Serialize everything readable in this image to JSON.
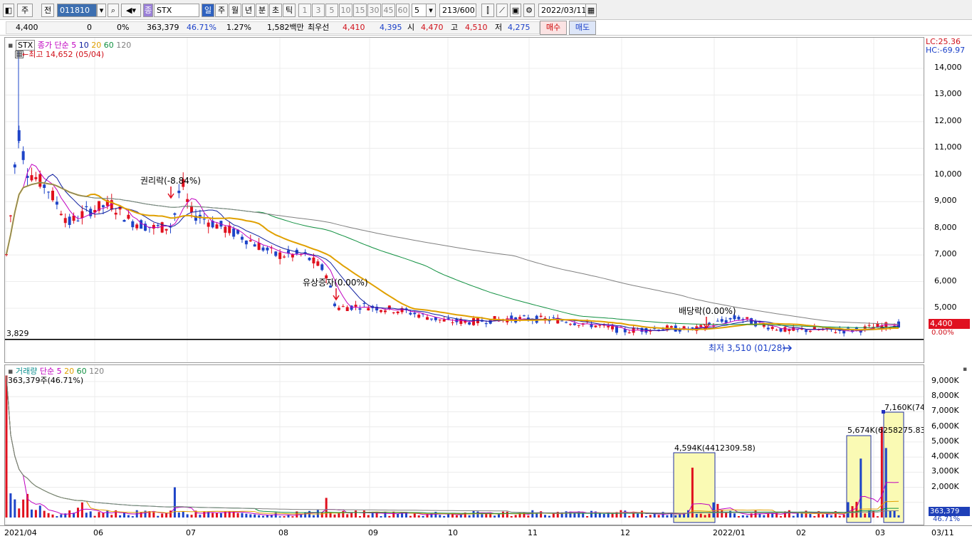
{
  "toolbar": {
    "period_type": "주",
    "prev_label": "전",
    "code": "011810",
    "name": "STX",
    "period_tabs": [
      "일",
      "주",
      "월",
      "년",
      "분",
      "초",
      "틱"
    ],
    "interval_tabs": [
      "1",
      "3",
      "5",
      "10",
      "15",
      "30",
      "45",
      "60"
    ],
    "interval_value": "5",
    "count": "213",
    "count_max": "/600",
    "date": "2022/03/11"
  },
  "quote": {
    "price": "4,400",
    "change": "0",
    "change_pct": "0%",
    "volume": "363,379",
    "turnover_pct": "46.71%",
    "vol_ratio": "1.27%",
    "amount": "1,582백만",
    "best_bid_label": "최우선",
    "best_ask": "4,410",
    "best_bid": "4,395",
    "open_label": "시",
    "open": "4,470",
    "high_label": "고",
    "high": "4,510",
    "low_label": "저",
    "low": "4,275",
    "buy_label": "매수",
    "sell_label": "매도"
  },
  "price_panel": {
    "symbol": "STX",
    "legend_title": "종가 단순",
    "legend_periods": [
      "5",
      "10",
      "20",
      "60",
      "120"
    ],
    "lc_label": "LC:25.36",
    "hc_label": "HC:-69.97",
    "max_label": "최고 14,652 (05/04)",
    "min_label": "최저 3,510 (01/28)",
    "line_value": "3,829",
    "current_price_label": "4,400",
    "current_pct_label": "0.00%",
    "annotations": [
      "권리락(-8.84%)",
      "유상증자(0.00%)",
      "배당락(0.00%)"
    ],
    "y_ticks": [
      "14,000",
      "13,000",
      "12,000",
      "11,000",
      "10,000",
      "9,000",
      "8,000",
      "7,000",
      "6,000",
      "5,000"
    ]
  },
  "volume_panel": {
    "legend_title": "거래량",
    "legend_ma": "단순",
    "legend_periods": [
      "5",
      "20",
      "60",
      "120"
    ],
    "volume_info": "363,379주(46.71%)",
    "callouts": [
      "4,594K(4412309.58)",
      "5,674K(6258275.83)",
      "7,160K(74"
    ],
    "y_ticks": [
      "9,000K",
      "8,000K",
      "7,000K",
      "6,000K",
      "5,000K",
      "4,000K",
      "3,000K",
      "2,000K"
    ],
    "current_volume_label": "363,379",
    "current_pct_label": "46.71%",
    "x_labels": [
      "2021/04",
      "06",
      "07",
      "08",
      "09",
      "10",
      "11",
      "12",
      "2022/01",
      "02",
      "03",
      "03/11"
    ]
  },
  "colors": {
    "up": "#e0101e",
    "down": "#1e44c8",
    "ma5": "#c000c0",
    "ma10": "#1020a0",
    "ma20": "#e0a000",
    "ma60": "#109040",
    "ma120": "#808080"
  }
}
